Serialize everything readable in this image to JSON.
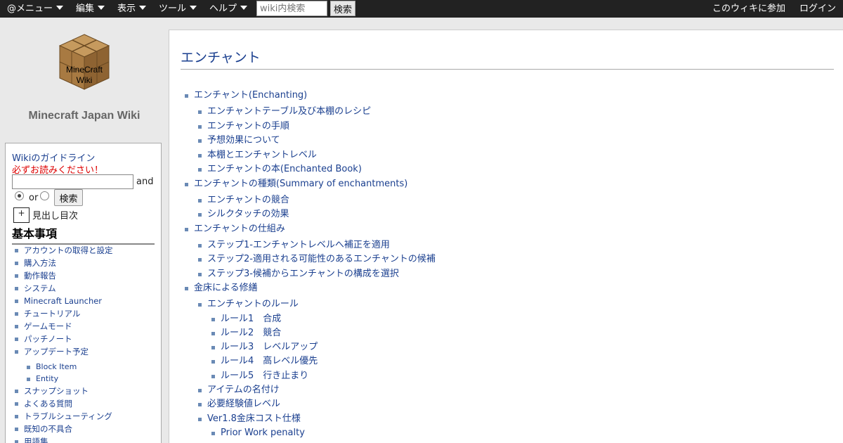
{
  "topbar": {
    "menu": "@メニュー",
    "edit": "編集",
    "view": "表示",
    "tools": "ツール",
    "help": "ヘルプ",
    "search_placeholder": "wiki内検索",
    "search_button": "検索",
    "join": "このウィキに参加",
    "login": "ログイン"
  },
  "sidebar": {
    "logo_text": "MineCraft\nWiki",
    "site_name": "Minecraft Japan Wiki",
    "guideline_link": "Wikiのガイドライン",
    "must_read": "必ずお読みください！",
    "and_label": "and",
    "or_label": "or",
    "search_button": "検索",
    "toc_toggle": "+",
    "toc_label": "見出し目次",
    "basics_heading": "基本事項",
    "items": [
      {
        "label": "アカウントの取得と設定",
        "level": 1
      },
      {
        "label": "購入方法",
        "level": 1
      },
      {
        "label": "動作報告",
        "level": 1
      },
      {
        "label": "システム",
        "level": 1
      },
      {
        "label": "Minecraft Launcher",
        "level": 1
      },
      {
        "label": "チュートリアル",
        "level": 1
      },
      {
        "label": "ゲームモード",
        "level": 1
      },
      {
        "label": "パッチノート",
        "level": 1
      },
      {
        "label": "アップデート予定",
        "level": 1
      },
      {
        "label": "Block Item",
        "level": 2
      },
      {
        "label": "Entity",
        "level": 2
      },
      {
        "label": "スナップショット",
        "level": 1
      },
      {
        "label": "よくある質問",
        "level": 1
      },
      {
        "label": "トラブルシューティング",
        "level": 1
      },
      {
        "label": "既知の不具合",
        "level": 1
      },
      {
        "label": "用語集",
        "level": 1
      }
    ]
  },
  "main": {
    "title": "エンチャント",
    "toc": [
      {
        "label": "エンチャント(Enchanting)",
        "level": 1
      },
      {
        "label": "エンチャントテーブル及び本棚のレシピ",
        "level": 2
      },
      {
        "label": "エンチャントの手順",
        "level": 2
      },
      {
        "label": "予想効果について",
        "level": 2
      },
      {
        "label": "本棚とエンチャントレベル",
        "level": 2
      },
      {
        "label": "エンチャントの本(Enchanted Book)",
        "level": 2
      },
      {
        "label": "エンチャントの種類(Summary of enchantments)",
        "level": 1
      },
      {
        "label": "エンチャントの競合",
        "level": 2
      },
      {
        "label": "シルクタッチの効果",
        "level": 2
      },
      {
        "label": "エンチャントの仕組み",
        "level": 1
      },
      {
        "label": "ステップ1-エンチャントレベルへ補正を適用",
        "level": 2
      },
      {
        "label": "ステップ2-適用される可能性のあるエンチャントの候補",
        "level": 2
      },
      {
        "label": "ステップ3-候補からエンチャントの構成を選択",
        "level": 2
      },
      {
        "label": "金床による修繕",
        "level": 1
      },
      {
        "label": "エンチャントのルール",
        "level": 2
      },
      {
        "label": "ルール1　合成",
        "level": 3
      },
      {
        "label": "ルール2　競合",
        "level": 3
      },
      {
        "label": "ルール3　レベルアップ",
        "level": 3
      },
      {
        "label": "ルール4　高レベル優先",
        "level": 3
      },
      {
        "label": "ルール5　行き止まり",
        "level": 3
      },
      {
        "label": "アイテムの名付け",
        "level": 2
      },
      {
        "label": "必要経験値レベル",
        "level": 2
      },
      {
        "label": "Ver1.8金床コスト仕様",
        "level": 2
      },
      {
        "label": "Prior Work penalty",
        "level": 3
      }
    ]
  }
}
